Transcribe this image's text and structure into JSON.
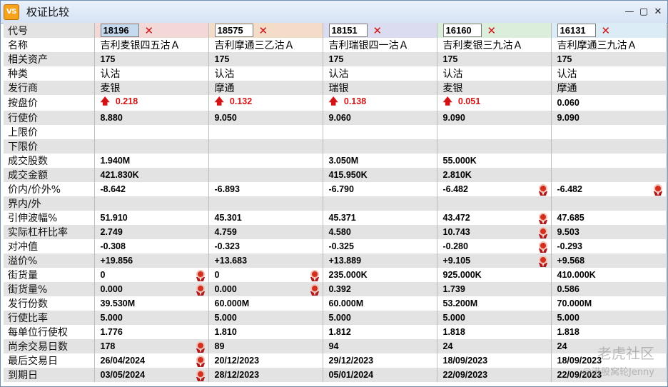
{
  "window": {
    "icon_text": "VS",
    "title": "权证比较",
    "controls": [
      "✕",
      "▢",
      "—"
    ]
  },
  "columns": [
    {
      "code": "18196",
      "selected": true
    },
    {
      "code": "18575",
      "selected": false
    },
    {
      "code": "18151",
      "selected": false
    },
    {
      "code": "16160",
      "selected": false
    },
    {
      "code": "16131",
      "selected": false
    }
  ],
  "remove_label": "✕",
  "code_label": "代号",
  "rows": [
    {
      "label": "名称",
      "kind": "txt",
      "cells": [
        {
          "v": "吉利麦银四五沽Ａ"
        },
        {
          "v": "吉利摩通三乙沽Ａ"
        },
        {
          "v": "吉利瑞银四一沽Ａ"
        },
        {
          "v": "吉利麦银三九沽Ａ"
        },
        {
          "v": "吉利摩通三九沽Ａ"
        }
      ]
    },
    {
      "label": "相关资产",
      "kind": "num",
      "cells": [
        {
          "v": "175"
        },
        {
          "v": "175"
        },
        {
          "v": "175"
        },
        {
          "v": "175"
        },
        {
          "v": "175"
        }
      ]
    },
    {
      "label": "种类",
      "kind": "txt",
      "cells": [
        {
          "v": "认沽"
        },
        {
          "v": "认沽"
        },
        {
          "v": "认沽"
        },
        {
          "v": "认沽"
        },
        {
          "v": "认沽"
        }
      ]
    },
    {
      "label": "发行商",
      "kind": "txt",
      "cells": [
        {
          "v": "麦银"
        },
        {
          "v": "摩通"
        },
        {
          "v": "瑞银"
        },
        {
          "v": "麦银"
        },
        {
          "v": "摩通"
        }
      ]
    },
    {
      "label": "按盘价",
      "kind": "num",
      "cells": [
        {
          "v": "0.218",
          "up": true
        },
        {
          "v": "0.132",
          "up": true
        },
        {
          "v": "0.138",
          "up": true
        },
        {
          "v": "0.051",
          "up": true
        },
        {
          "v": "0.060"
        }
      ]
    },
    {
      "label": "行使价",
      "kind": "num",
      "cells": [
        {
          "v": "8.880"
        },
        {
          "v": "9.050"
        },
        {
          "v": "9.060"
        },
        {
          "v": "9.090"
        },
        {
          "v": "9.090"
        }
      ]
    },
    {
      "label": "上限价",
      "kind": "num",
      "cells": [
        {
          "v": ""
        },
        {
          "v": ""
        },
        {
          "v": ""
        },
        {
          "v": ""
        },
        {
          "v": ""
        }
      ]
    },
    {
      "label": "下限价",
      "kind": "num",
      "cells": [
        {
          "v": ""
        },
        {
          "v": ""
        },
        {
          "v": ""
        },
        {
          "v": ""
        },
        {
          "v": ""
        }
      ]
    },
    {
      "label": "成交股数",
      "kind": "num",
      "cells": [
        {
          "v": "1.940M"
        },
        {
          "v": ""
        },
        {
          "v": "3.050M"
        },
        {
          "v": "55.000K"
        },
        {
          "v": ""
        }
      ]
    },
    {
      "label": "成交金额",
      "kind": "num",
      "cells": [
        {
          "v": "421.830K"
        },
        {
          "v": ""
        },
        {
          "v": "415.950K"
        },
        {
          "v": "2.810K"
        },
        {
          "v": ""
        }
      ]
    },
    {
      "label": "价内/价外%",
      "kind": "num",
      "cells": [
        {
          "v": "-8.642"
        },
        {
          "v": "-6.893"
        },
        {
          "v": "-6.790"
        },
        {
          "v": "-6.482",
          "medal": true
        },
        {
          "v": "-6.482",
          "medal": true
        }
      ]
    },
    {
      "label": "界内/外",
      "kind": "num",
      "cells": [
        {
          "v": ""
        },
        {
          "v": ""
        },
        {
          "v": ""
        },
        {
          "v": ""
        },
        {
          "v": ""
        }
      ]
    },
    {
      "label": "引伸波幅%",
      "kind": "num",
      "cells": [
        {
          "v": "51.910"
        },
        {
          "v": "45.301"
        },
        {
          "v": "45.371"
        },
        {
          "v": "43.472",
          "medal": true
        },
        {
          "v": "47.685"
        }
      ]
    },
    {
      "label": "实际杠杆比率",
      "kind": "num",
      "cells": [
        {
          "v": "2.749"
        },
        {
          "v": "4.759"
        },
        {
          "v": "4.580"
        },
        {
          "v": "10.743",
          "medal": true
        },
        {
          "v": "9.503"
        }
      ]
    },
    {
      "label": "对冲值",
      "kind": "num",
      "cells": [
        {
          "v": "-0.308"
        },
        {
          "v": "-0.323"
        },
        {
          "v": "-0.325"
        },
        {
          "v": "-0.280",
          "medal": true
        },
        {
          "v": "-0.293"
        }
      ]
    },
    {
      "label": "溢价%",
      "kind": "num",
      "cells": [
        {
          "v": "+19.856"
        },
        {
          "v": "+13.683"
        },
        {
          "v": "+13.889"
        },
        {
          "v": "+9.105",
          "medal": true
        },
        {
          "v": "+9.568"
        }
      ]
    },
    {
      "label": "街货量",
      "kind": "num",
      "cells": [
        {
          "v": "0",
          "medal": true
        },
        {
          "v": "0",
          "medal": true
        },
        {
          "v": "235.000K"
        },
        {
          "v": "925.000K"
        },
        {
          "v": "410.000K"
        }
      ]
    },
    {
      "label": "街货量%",
      "kind": "num",
      "cells": [
        {
          "v": "0.000",
          "medal": true
        },
        {
          "v": "0.000",
          "medal": true
        },
        {
          "v": "0.392"
        },
        {
          "v": "1.739"
        },
        {
          "v": "0.586"
        }
      ]
    },
    {
      "label": "发行份数",
      "kind": "num",
      "cells": [
        {
          "v": "39.530M"
        },
        {
          "v": "60.000M"
        },
        {
          "v": "60.000M"
        },
        {
          "v": "53.200M"
        },
        {
          "v": "70.000M"
        }
      ]
    },
    {
      "label": "行使比率",
      "kind": "num",
      "cells": [
        {
          "v": "5.000"
        },
        {
          "v": "5.000"
        },
        {
          "v": "5.000"
        },
        {
          "v": "5.000"
        },
        {
          "v": "5.000"
        }
      ]
    },
    {
      "label": "每单位行使权",
      "kind": "num",
      "cells": [
        {
          "v": "1.776"
        },
        {
          "v": "1.810"
        },
        {
          "v": "1.812"
        },
        {
          "v": "1.818"
        },
        {
          "v": "1.818"
        }
      ]
    },
    {
      "label": "尚余交易日数",
      "kind": "num",
      "cells": [
        {
          "v": "178",
          "medal": true
        },
        {
          "v": "89"
        },
        {
          "v": "94"
        },
        {
          "v": "24"
        },
        {
          "v": "24"
        }
      ]
    },
    {
      "label": "最后交易日",
      "kind": "num",
      "cells": [
        {
          "v": "26/04/2024",
          "medal": true
        },
        {
          "v": "20/12/2023"
        },
        {
          "v": "29/12/2023"
        },
        {
          "v": "18/09/2023"
        },
        {
          "v": "18/09/2023"
        }
      ]
    },
    {
      "label": "到期日",
      "kind": "num",
      "cells": [
        {
          "v": "03/05/2024",
          "medal": true
        },
        {
          "v": "28/12/2023"
        },
        {
          "v": "05/01/2024"
        },
        {
          "v": "22/09/2023"
        },
        {
          "v": "22/09/2023"
        }
      ]
    }
  ],
  "watermark": {
    "line1": "老虎社区",
    "line2": "@港股窝轮Jenny"
  }
}
